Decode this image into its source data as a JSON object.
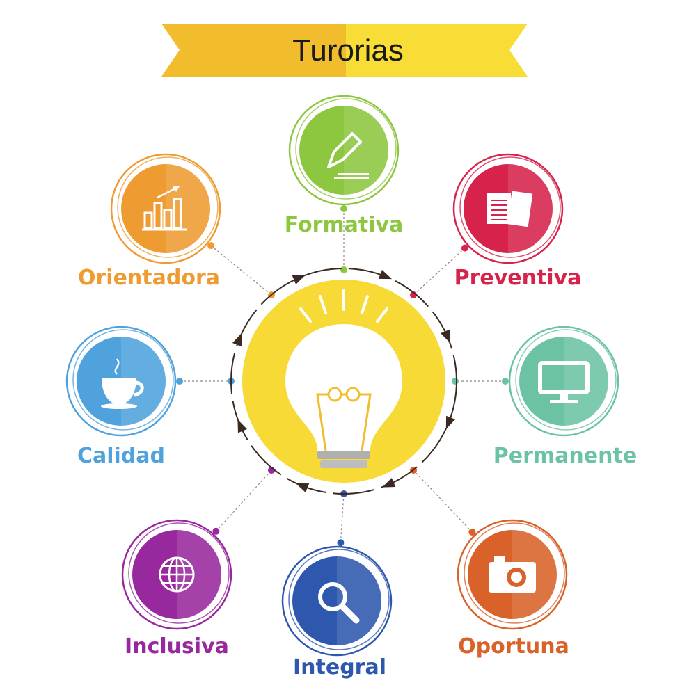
{
  "title": "Turorias",
  "banner_colors": {
    "left": "#F2BD2C",
    "right": "#F7DD35"
  },
  "center": {
    "icon": "lightbulb-icon",
    "color": "#F7DA35"
  },
  "nodes": [
    {
      "key": "formativa",
      "label": "Formativa",
      "color": "#8DC63F",
      "icon": "pencil-icon"
    },
    {
      "key": "preventiva",
      "label": "Preventiva",
      "color": "#D7234C",
      "icon": "document-icon"
    },
    {
      "key": "permanente",
      "label": "Permanente",
      "color": "#6CC3A3",
      "icon": "monitor-icon"
    },
    {
      "key": "oportuna",
      "label": "Oportuna",
      "color": "#D9622A",
      "icon": "camera-icon"
    },
    {
      "key": "integral",
      "label": "Integral",
      "color": "#2E58AE",
      "icon": "magnifier-icon"
    },
    {
      "key": "inclusiva",
      "label": "Inclusiva",
      "color": "#98289E",
      "icon": "globe-icon"
    },
    {
      "key": "calidad",
      "label": "Calidad",
      "color": "#4FA2DC",
      "icon": "coffee-cup-icon"
    },
    {
      "key": "orientadora",
      "label": "Orientadora",
      "color": "#EE9B31",
      "icon": "bar-chart-icon"
    }
  ]
}
